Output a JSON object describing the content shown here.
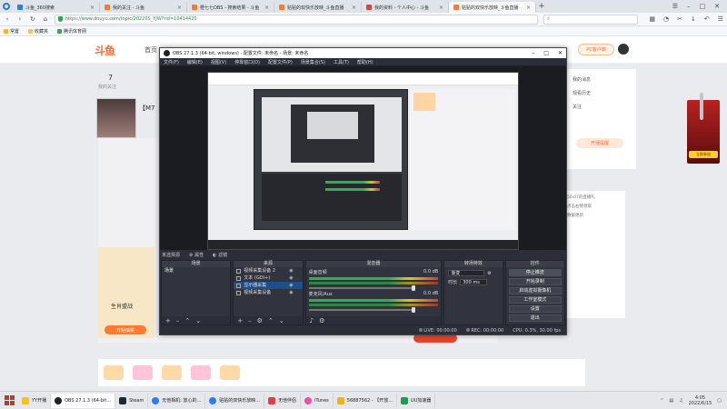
{
  "browser": {
    "tabs": [
      {
        "label": "斗鱼_360搜索",
        "favicon": "blue",
        "active": false
      },
      {
        "label": "我的关注 - 斗鱼",
        "favicon": "orange",
        "active": false
      },
      {
        "label": "橙七七OBS - 搜索结果 - 斗鱼",
        "favicon": "orange",
        "active": false
      },
      {
        "label": "贴贴的双快乐放映_斗鱼直播",
        "favicon": "orange",
        "active": false
      },
      {
        "label": "我的资料 - 个人中心 - 斗鱼",
        "favicon": "red",
        "active": false
      },
      {
        "label": "贴贴的双快乐放映_斗鱼直播",
        "favicon": "orange",
        "active": true
      }
    ],
    "new_tab": "+",
    "window_controls": [
      "☰",
      "–",
      "□",
      "✕"
    ],
    "url": "https://www.douyu.com/topic/20220S_YJW?rid=10414420",
    "search_placeholder": "",
    "bookmarks": [
      "常置",
      "收藏夹",
      "腾讯体育网"
    ]
  },
  "page": {
    "logo": "斗鱼",
    "nav_text": "首页",
    "pc_button": "PC客户端",
    "follow_count": "7",
    "follow_label": "我的关注",
    "streamer_name": "【M7",
    "gift_label": "生肖盟战",
    "gift_button": "开始抽奖",
    "right_items": [
      "我的消息",
      "观看历史",
      "关注"
    ],
    "pill_button": "开播提醒",
    "ad_button": "立即参加",
    "chat_lines": [
      "50.07的直播礼",
      "点击右侧领取",
      "数据更新"
    ]
  },
  "obs": {
    "title": "OBS 27.1.3 (64-bit, windows) - 配置文件: 未命名 - 场景: 未命名",
    "menu": [
      "文件(F)",
      "编辑(E)",
      "视图(V)",
      "停靠窗口(D)",
      "配置文件(P)",
      "场景集合(S)",
      "工具(T)",
      "帮助(H)"
    ],
    "toolbar": [
      "未选择源",
      "属性",
      "滤镜"
    ],
    "docks": {
      "scenes": {
        "title": "场景",
        "items": [
          "场景"
        ]
      },
      "sources": {
        "title": "来源",
        "items": [
          {
            "label": "视频采集设备 2",
            "selected": false
          },
          {
            "label": "文本 (GDI+)",
            "selected": false
          },
          {
            "label": "显示器采集",
            "selected": true
          },
          {
            "label": "视频采集设备",
            "selected": false
          }
        ]
      },
      "mixer": {
        "title": "混音器",
        "tracks": [
          {
            "name": "桌面音频",
            "db": "0.0 dB"
          },
          {
            "name": "麦克风/Aux",
            "db": "0.0 dB"
          }
        ]
      },
      "transitions": {
        "title": "转场特效",
        "type": "渐变",
        "duration_label": "时长",
        "duration": "300 ms"
      },
      "controls": {
        "title": "控件",
        "buttons": [
          "停止推流",
          "开始录制",
          "启动虚拟摄像机",
          "工作室模式",
          "设置",
          "退出"
        ]
      }
    },
    "status": {
      "live": "LIVE: 00:00:00",
      "rec": "REC: 00:00:00",
      "cpu": "CPU: 0.3%, 30.00 fps"
    }
  },
  "taskbar": {
    "items": [
      {
        "label": "YY开播",
        "active": false
      },
      {
        "label": "OBS 27.1.3 (64-bit...",
        "active": true
      },
      {
        "label": "Steam",
        "active": false
      },
      {
        "label": "无他相机: 放心的...",
        "active": false
      },
      {
        "label": "贴贴的双快乐放映...",
        "active": false
      },
      {
        "label": "无他伴侣",
        "active": false
      },
      {
        "label": "iTunes",
        "active": false
      },
      {
        "label": "56887562 - 【开放...",
        "active": false
      },
      {
        "label": "UU加速器",
        "active": false
      }
    ],
    "time": "4:05",
    "date": "2022/6/15"
  }
}
